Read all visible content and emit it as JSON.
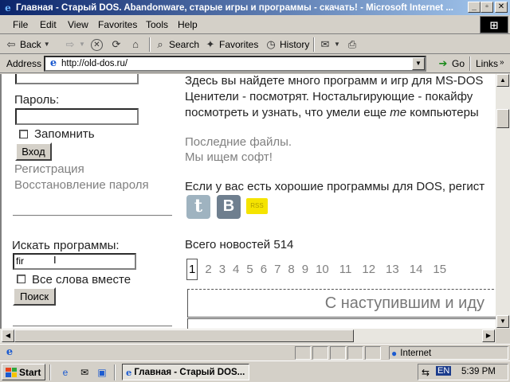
{
  "window": {
    "title": "Главная - Старый DOS. Abandonware, старые игры и программы - скачать! - Microsoft Internet ...",
    "buttons": {
      "minimize": "_",
      "maximize": "▫",
      "close": "✕"
    }
  },
  "menubar": {
    "items": [
      "File",
      "Edit",
      "View",
      "Favorites",
      "Tools",
      "Help"
    ]
  },
  "toolbar": {
    "back": "Back",
    "search": "Search",
    "favorites": "Favorites",
    "history": "History"
  },
  "addressbar": {
    "label": "Address",
    "url": "http://old-dos.ru/",
    "go": "Go",
    "links": "Links"
  },
  "sidebar": {
    "password_label": "Пароль:",
    "remember_label": "Запомнить",
    "login_button": "Вход",
    "register_link": "Регистрация",
    "restore_link": "Восстановление пароля",
    "search_label": "Искать программы:",
    "search_value": "fir",
    "all_words_label": "Все слова вместе",
    "search_button": "Поиск"
  },
  "main": {
    "intro_lines": [
      "Здесь вы найдете много программ и игр для MS-DOS",
      "Ценители - посмотрят. Ностальгирующие - покайфу",
      "посмотреть и узнать, что умели еще ",
      "те",
      " компьютеры"
    ],
    "recent_files_link": "Последние файлы.",
    "wanted_link": "Мы ищем софт!",
    "programs_text": "Если у вас есть хорошие программы для DOS, регист",
    "social": [
      {
        "name": "twitter",
        "glyph": "t",
        "color": "#9fb3c0"
      },
      {
        "name": "vkontakte",
        "glyph": "B",
        "color": "#6f7f8f"
      },
      {
        "name": "rss",
        "glyph": "RSS",
        "color": "#f5e400"
      }
    ],
    "news_count": "Всего новостей 514",
    "pages": [
      "1",
      "2",
      "3",
      "4",
      "5",
      "6",
      "7",
      "8",
      "9",
      "10",
      "11",
      "12",
      "13",
      "14",
      "15"
    ],
    "current_page": "1",
    "news_title": "С наступившим и иду"
  },
  "statusbar": {
    "zone": "Internet"
  },
  "taskbar": {
    "start": "Start",
    "task_title": "Главная - Старый DOS...",
    "language": "EN",
    "clock": "5:39 PM"
  }
}
